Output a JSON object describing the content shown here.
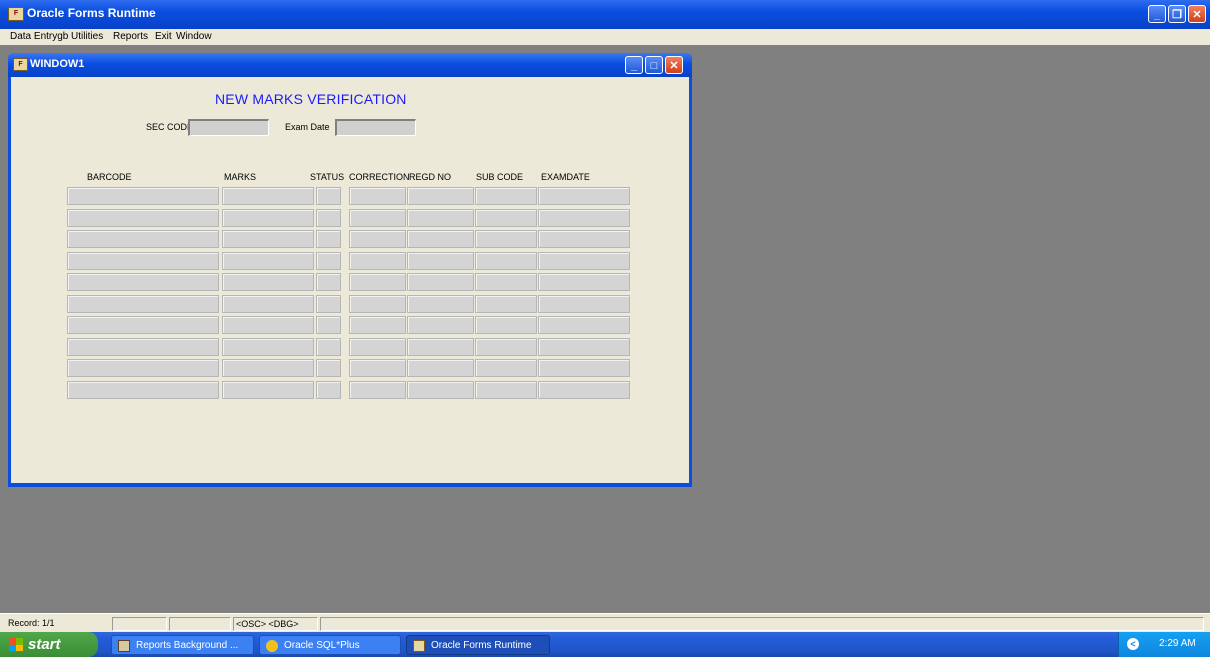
{
  "app": {
    "title": "Oracle Forms Runtime",
    "menu": [
      "Data Entrygb",
      "Utilities",
      "Reports",
      "Exit",
      "Window"
    ]
  },
  "window": {
    "title": "WINDOW1",
    "form_title": "NEW MARKS VERIFICATION",
    "sec_code_label": "SEC CODE",
    "exam_date_label": "Exam Date",
    "columns": [
      "BARCODE",
      "MARKS",
      "STATUS",
      "CORRECTION",
      "REGD NO",
      "SUB CODE",
      "EXAMDATE"
    ],
    "row_count": 10
  },
  "statusbar": {
    "record": "Record: 1/1",
    "indicators": "<OSC> <DBG>"
  },
  "taskbar": {
    "start_label": "start",
    "tasks": [
      "Reports Background ...",
      "Oracle SQL*Plus",
      "Oracle Forms Runtime"
    ],
    "clock": "2:29 AM"
  },
  "colors": {
    "title_blue": "#0a4ee0",
    "form_title": "#1a1aff",
    "canvas_bg": "#ece9d8",
    "workspace": "#808080",
    "start_green": "#3a8d35"
  },
  "icons": {
    "app": "oracle-forms-icon",
    "minimize": "minimize-icon",
    "restore": "restore-icon",
    "maximize": "maximize-icon",
    "close": "close-icon",
    "windows_flag": "windows-logo-icon",
    "tray": "network-icon"
  }
}
